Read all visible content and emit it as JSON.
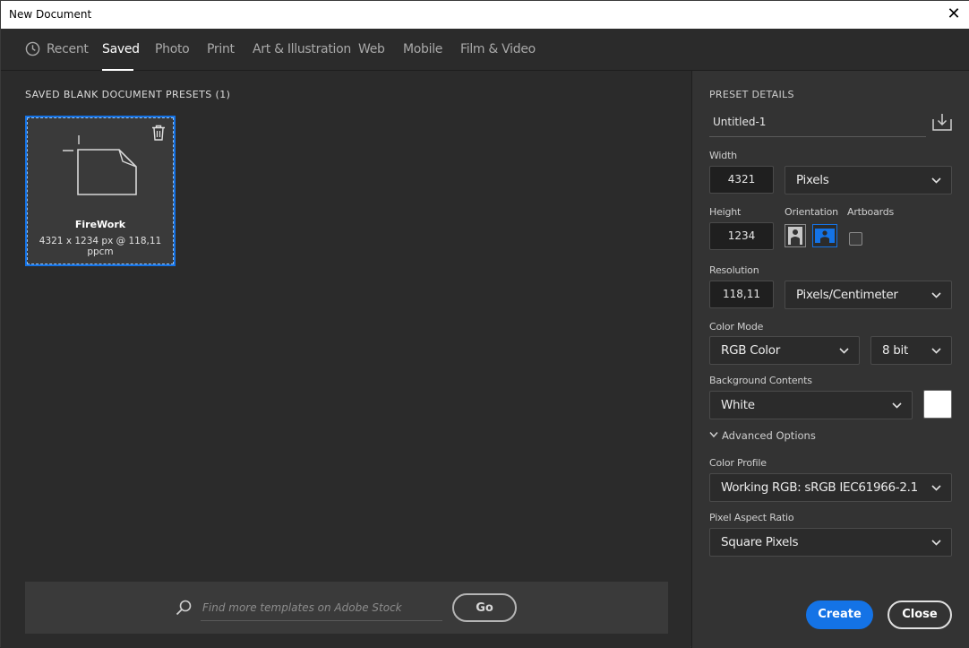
{
  "window": {
    "title": "New Document",
    "close_glyph": "✕"
  },
  "tabs": [
    {
      "label": "Recent"
    },
    {
      "label": "Saved"
    },
    {
      "label": "Photo"
    },
    {
      "label": "Print"
    },
    {
      "label": "Art & Illustration"
    },
    {
      "label": "Web"
    },
    {
      "label": "Mobile"
    },
    {
      "label": "Film & Video"
    }
  ],
  "active_tab": "Saved",
  "presets": {
    "section_title": "SAVED BLANK DOCUMENT PRESETS  (1)",
    "items": [
      {
        "name": "FireWork",
        "dims": "4321 x 1234 px @ 118,11 ppcm"
      }
    ]
  },
  "stock": {
    "placeholder": "Find more templates on Adobe Stock",
    "go_label": "Go"
  },
  "details": {
    "header": "PRESET DETAILS",
    "preset_name": "Untitled-1",
    "width_label": "Width",
    "width_value": "4321",
    "width_unit": "Pixels",
    "height_label": "Height",
    "height_value": "1234",
    "orientation_label": "Orientation",
    "artboards_label": "Artboards",
    "resolution_label": "Resolution",
    "resolution_value": "118,11",
    "resolution_unit": "Pixels/Centimeter",
    "color_mode_label": "Color Mode",
    "color_mode": "RGB Color",
    "bit_depth": "8 bit",
    "background_label": "Background Contents",
    "background": "White",
    "advanced_label": "Advanced Options",
    "color_profile_label": "Color Profile",
    "color_profile": "Working RGB: sRGB IEC61966-2.1",
    "pixel_aspect_label": "Pixel Aspect Ratio",
    "pixel_aspect": "Square Pixels",
    "create_label": "Create",
    "close_label": "Close"
  },
  "colors": {
    "accent": "#1473e6",
    "panel_bg": "#333333",
    "main_bg": "#2b2b2b",
    "swatch": "#ffffff"
  },
  "icons": {
    "recent": "clock-icon",
    "delete": "trash-icon",
    "preset": "document-icon",
    "search": "search-icon",
    "save_preset": "save-preset-icon",
    "portrait": "portrait-orientation-icon",
    "landscape": "landscape-orientation-icon",
    "dropdown": "chevron-down-icon"
  }
}
